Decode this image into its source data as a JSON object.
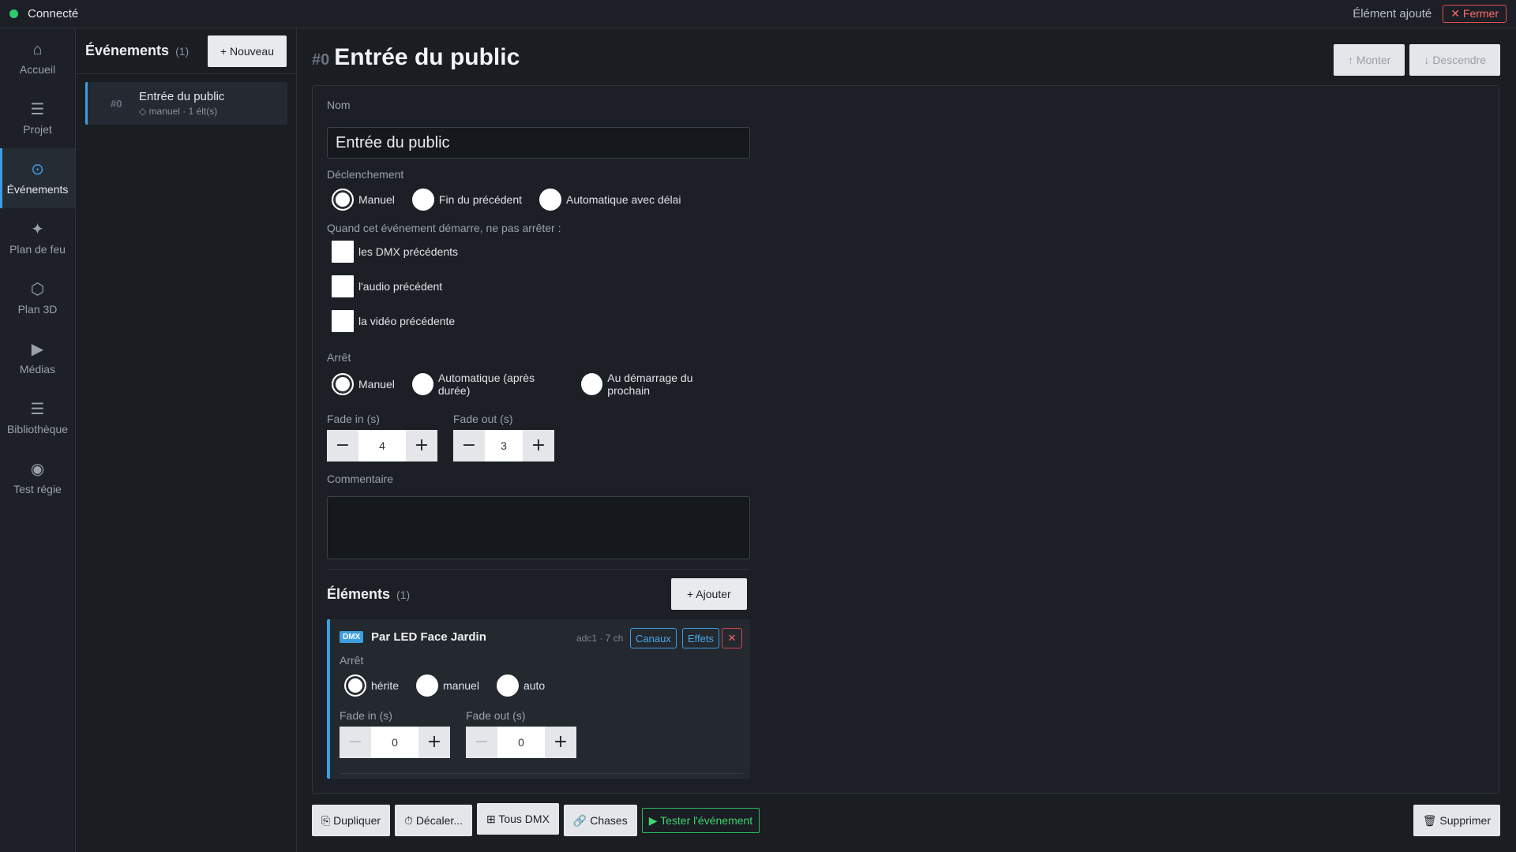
{
  "topbar": {
    "status": "Connecté",
    "toast": "Élément ajouté",
    "close_label": "✕ Fermer"
  },
  "nav": {
    "items": [
      {
        "icon": "home-icon",
        "glyph": "⌂",
        "label": "Accueil"
      },
      {
        "icon": "menu-icon",
        "glyph": "☰",
        "label": "Projet"
      },
      {
        "icon": "target-icon",
        "glyph": "⊙",
        "label": "Événements",
        "active": true
      },
      {
        "icon": "sparkle-icon",
        "glyph": "✦",
        "label": "Plan de feu"
      },
      {
        "icon": "hexagon-icon",
        "glyph": "⬡",
        "label": "Plan 3D"
      },
      {
        "icon": "play-icon",
        "glyph": "▶",
        "label": "Médias"
      },
      {
        "icon": "list-icon",
        "glyph": "☰",
        "label": "Bibliothèque"
      },
      {
        "icon": "radio-icon",
        "glyph": "◉",
        "label": "Test régie"
      }
    ]
  },
  "events_panel": {
    "title": "Événements",
    "count": "(1)",
    "new_label": "+ Nouveau",
    "items": [
      {
        "num": "#0",
        "name": "Entrée du public",
        "meta": "◇ manuel · 1 élt(s)"
      }
    ]
  },
  "main": {
    "num": "#0",
    "title": "Entrée du public",
    "move_up": "↑ Monter",
    "move_down": "↓ Descendre",
    "form": {
      "name_label": "Nom",
      "name_value": "Entrée du public",
      "trigger_label": "Déclenchement",
      "trigger_options": [
        "Manuel",
        "Fin du précédent",
        "Automatique avec délai"
      ],
      "trigger_selected": "Manuel",
      "nostop_label": "Quand cet événement démarre, ne pas arrêter :",
      "nostop_options": [
        "les DMX précédents",
        "l'audio précédent",
        "la vidéo précédente"
      ],
      "stop_label": "Arrêt",
      "stop_options": [
        "Manuel",
        "Automatique (après durée)",
        "Au démarrage du prochain"
      ],
      "stop_selected": "Manuel",
      "fade_in_label": "Fade in (s)",
      "fade_in_value": "4",
      "fade_out_label": "Fade out (s)",
      "fade_out_value": "3",
      "comment_label": "Commentaire",
      "elements_title": "Éléments",
      "elements_count": "(1)",
      "add_label": "+ Ajouter"
    },
    "element": {
      "badge": "DMX",
      "name": "Par LED Face Jardin",
      "meta": "adc1 · 7 ch",
      "channels_label": "Canaux",
      "effects_label": "Effets",
      "remove_label": "✕",
      "stop_label": "Arrêt",
      "stop_options": [
        "hérite",
        "manuel",
        "auto"
      ],
      "stop_selected": "hérite",
      "fade_in_label": "Fade in (s)",
      "fade_in_value": "0",
      "fade_out_label": "Fade out (s)",
      "fade_out_value": "0"
    },
    "bottom": {
      "duplicate": "⎘ Dupliquer",
      "shift": "⏱ Décaler...",
      "all_dmx": "⊞ Tous DMX",
      "chases": "🔗 Chases",
      "test": "▶ Tester l'événement",
      "delete": "🗑 Supprimer"
    }
  },
  "colors": {
    "accent": "#3b9fe0",
    "status_ok": "#2ecc71",
    "danger": "#e04b4b",
    "success": "#2ebd5f"
  }
}
